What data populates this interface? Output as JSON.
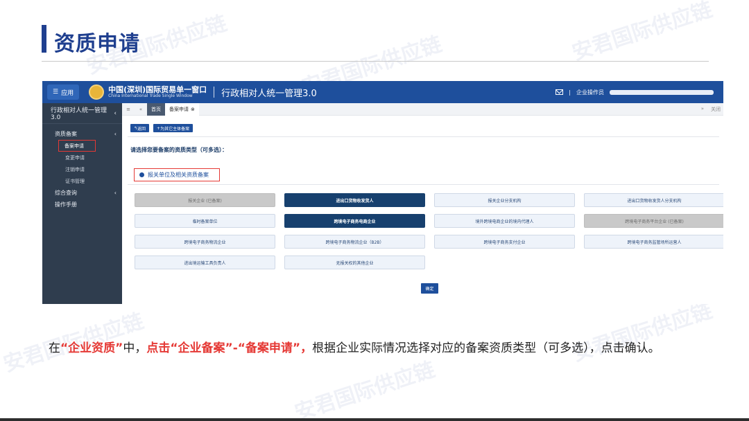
{
  "slide": {
    "title": "资质申请",
    "watermark": "安君国际供应链",
    "caption": {
      "p1": "在",
      "r1": "“企业资质”",
      "p2": "中，",
      "r2": "点击“企业备案”-“备案申请”，",
      "p3": "根据企业实际情况选择对应的备案资质类型（可多选），点击确认。"
    }
  },
  "colors": {
    "brand": "#1e4f9c",
    "title": "#1f3f8f",
    "highlight": "#e53935",
    "selected": "#17406e"
  },
  "topbar": {
    "menu_label": "应用",
    "brand_cn": "中国(深圳)国际贸易单一窗口",
    "brand_en": "China International Trade Single Window",
    "system_title": "行政相对人统一管理3.0",
    "user_label": "企业操作员"
  },
  "sidebar": {
    "header": "行政相对人统一管理3.0",
    "group1": "资质备案",
    "items": [
      "备案申请",
      "变更申请",
      "注销申请",
      "证书管理"
    ],
    "group2": "综合查询",
    "group3": "操作手册"
  },
  "tabs": {
    "home": "首页",
    "current": "备案申请",
    "close": "关闭"
  },
  "actions": {
    "back": "返回",
    "add": "为其它主体备案"
  },
  "form": {
    "prompt": "请选择您要备案的资质类型（可多选）：",
    "radio_label": "报关单位及相关资质备案",
    "options": [
      {
        "label": "报关企业 (已备案)",
        "state": "disabled"
      },
      {
        "label": "进出口货物收发货人",
        "state": "selected"
      },
      {
        "label": "报关企业分支机构",
        "state": "normal"
      },
      {
        "label": "进出口货物收发货人分支机构",
        "state": "normal"
      },
      {
        "label": "临时备案单位",
        "state": "normal"
      },
      {
        "label": "跨境电子商务电商企业",
        "state": "selected"
      },
      {
        "label": "境外跨境电商企业的境内代理人",
        "state": "normal"
      },
      {
        "label": "跨境电子商务平台企业 (已备案)",
        "state": "disabled"
      },
      {
        "label": "跨境电子商务物流企业",
        "state": "normal"
      },
      {
        "label": "跨境电子商务物流企业（B2B）",
        "state": "normal"
      },
      {
        "label": "跨境电子商务支付企业",
        "state": "normal"
      },
      {
        "label": "跨境电子商务监管场所运营人",
        "state": "normal"
      },
      {
        "label": "进出境运输工具负责人",
        "state": "normal"
      },
      {
        "label": "无报关权的其他企业",
        "state": "normal"
      }
    ],
    "confirm": "确定"
  }
}
